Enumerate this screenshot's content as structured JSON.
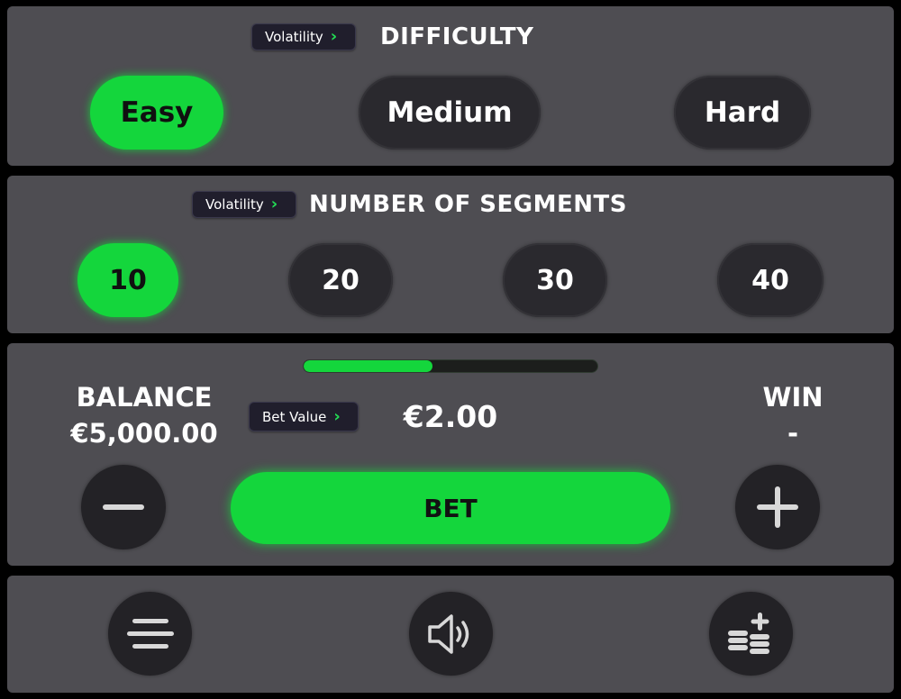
{
  "difficulty": {
    "tag_label": "Volatility",
    "title": "DIFFICULTY",
    "options": [
      "Easy",
      "Medium",
      "Hard"
    ],
    "selected": "Easy"
  },
  "segments": {
    "tag_label": "Volatility",
    "title": "NUMBER OF SEGMENTS",
    "options": [
      "10",
      "20",
      "30",
      "40"
    ],
    "selected": "10"
  },
  "bet": {
    "progress_fraction": 0.44,
    "balance_label": "BALANCE",
    "balance_value": "€5,000.00",
    "tag_label": "Bet Value",
    "bet_value": "€2.00",
    "win_label": "WIN",
    "win_value": "-",
    "bet_button_label": "BET",
    "decrease_icon": "minus-icon",
    "increase_icon": "plus-icon"
  },
  "footer": {
    "menu_icon": "menu-icon",
    "sound_icon": "speaker-icon",
    "coins_icon": "coins-plus-icon"
  },
  "colors": {
    "accent": "#14d63c",
    "panel": "#4e4d52",
    "button_dark": "#2a292e",
    "tag_bg": "#201e2c"
  }
}
